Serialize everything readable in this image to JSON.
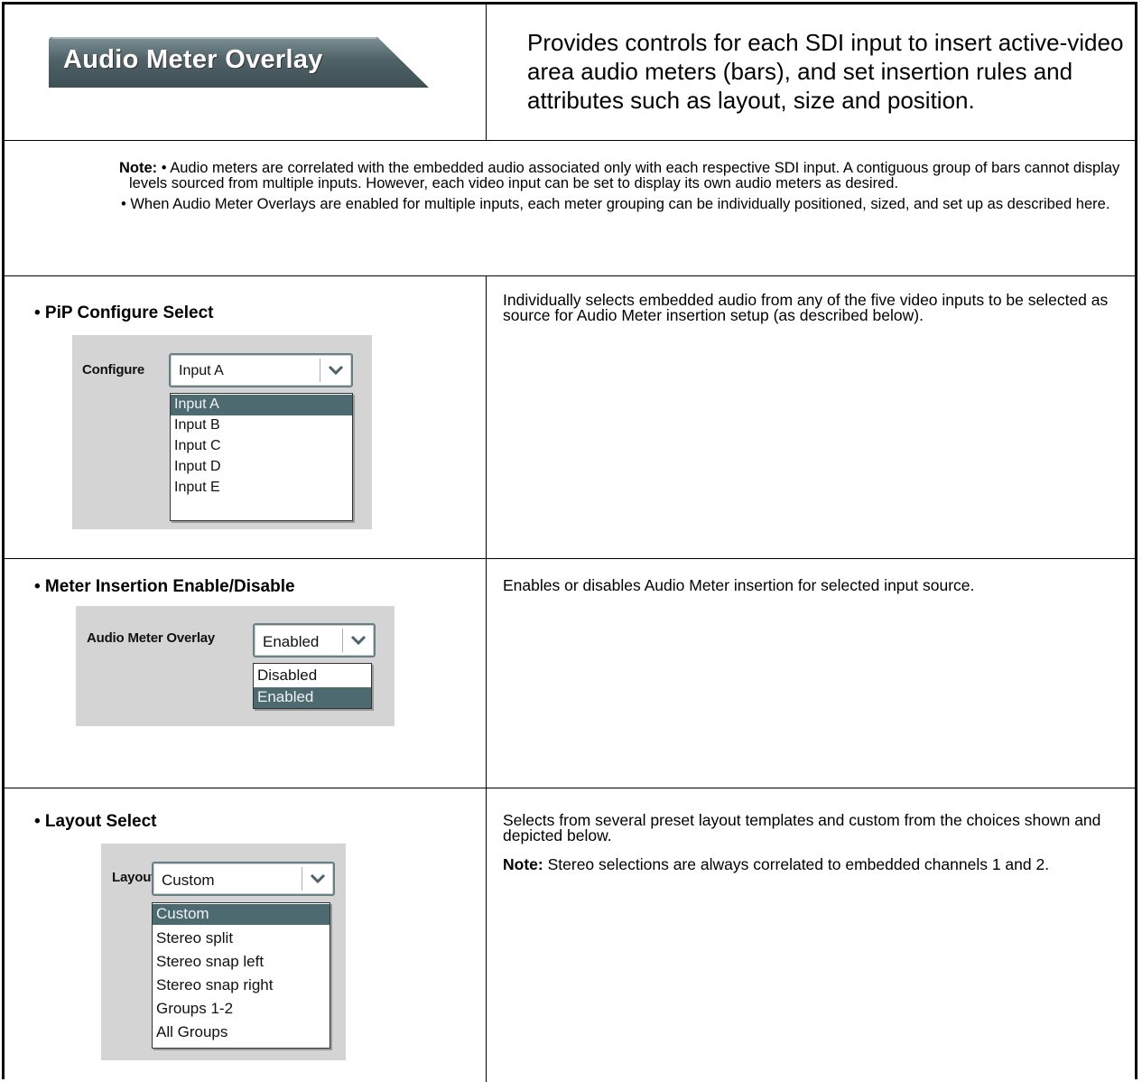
{
  "header": {
    "tab_label": "Audio Meter Overlay",
    "description": "Provides controls for each SDI input to insert active-video area audio meters (bars), and set insertion rules and attributes such as layout, size and position."
  },
  "note": {
    "label": "Note:",
    "bullet1": "• Audio meters are correlated with the embedded audio associated only with each respective SDI input. A contiguous group of bars cannot display levels sourced from multiple inputs. However, each video input can be set to display its own audio meters as desired.",
    "bullet2": "• When Audio Meter Overlays are enabled for multiple inputs, each meter grouping can be individually positioned, sized, and set up as described here."
  },
  "sections": [
    {
      "title": "• PiP Configure Select",
      "control_label": "Configure",
      "value": "Input A",
      "options": [
        "Input A",
        "Input B",
        "Input C",
        "Input D",
        "Input E"
      ],
      "description": "Individually selects embedded audio from any of the five video inputs to be selected as source for Audio Meter insertion setup (as described below)."
    },
    {
      "title": "• Meter Insertion Enable/Disable",
      "control_label": "Audio Meter Overlay",
      "value": "Enabled",
      "options": [
        "Disabled",
        "Enabled"
      ],
      "description": "Enables or disables Audio Meter insertion for selected input source."
    },
    {
      "title": "• Layout Select",
      "control_label": "Layout",
      "value": "Custom",
      "options": [
        "Custom",
        "Stereo split",
        "Stereo snap left",
        "Stereo snap right",
        "Groups 1-2",
        "All Groups"
      ],
      "description": "Selects from several preset layout templates and custom from the choices shown and depicted below.",
      "note_label": "Note:",
      "note_text": "Stereo selections are always correlated to embedded channels 1 and 2."
    }
  ],
  "colors": {
    "tab_fill": "#4b5d63",
    "selected_option": "#4e6a71",
    "panel_bg": "#d4d4d4"
  }
}
